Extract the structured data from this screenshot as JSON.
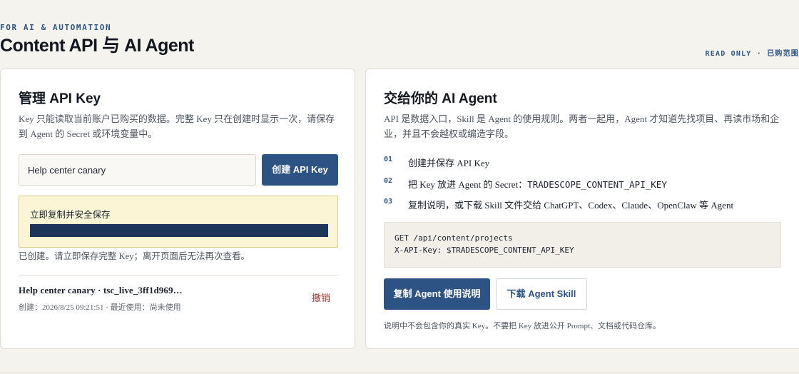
{
  "header": {
    "eyebrow": "FOR AI & AUTOMATION",
    "title": "Content API 与 AI Agent",
    "scope_note": "READ ONLY · 已购范围"
  },
  "manage_card": {
    "title": "管理 API Key",
    "description": "Key 只能读取当前账户已购买的数据。完整 Key 只在创建时显示一次，请保存到 Agent 的 Secret 或环境变量中。",
    "name_input_value": "Help center canary",
    "create_button": "创建 API Key",
    "notice_label": "立即复制并安全保存",
    "created_note": "已创建。请立即保存完整 Key；离开页面后无法再次查看。",
    "keys": [
      {
        "name": "Help center canary · tsc_live_3ff1d969…",
        "meta": "创建：2026/8/25 09:21:51 · 最近使用：尚未使用",
        "revoke_label": "撤销"
      }
    ]
  },
  "agent_card": {
    "title": "交给你的 AI Agent",
    "description": "API 是数据入口，Skill 是 Agent 的使用规则。两者一起用，Agent 才知道先找项目、再读市场和企业，并且不会越权或编造字段。",
    "steps": [
      {
        "num": "01",
        "text": "创建并保存 API Key",
        "code": ""
      },
      {
        "num": "02",
        "text": "把 Key 放进 Agent 的 Secret：",
        "code": "TRADESCOPE_CONTENT_API_KEY"
      },
      {
        "num": "03",
        "text": "复制说明，或下载 Skill 文件交给 ChatGPT、Codex、Claude、OpenClaw 等 Agent",
        "code": ""
      }
    ],
    "code_lines": [
      "GET /api/content/projects",
      "X-API-Key: $TRADESCOPE_CONTENT_API_KEY"
    ],
    "copy_button": "复制 Agent 使用说明",
    "download_button": "下载 Agent Skill",
    "footnote": "说明中不会包含你的真实 Key。不要把 Key 放进公开 Prompt、文档或代码仓库。"
  }
}
